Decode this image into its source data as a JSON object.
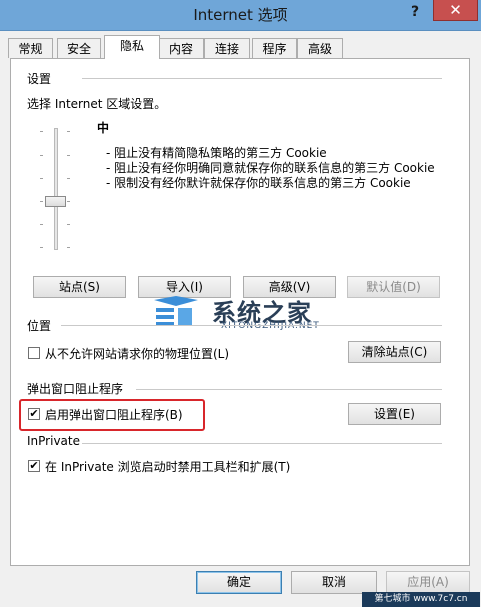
{
  "window": {
    "title": "Internet 选项",
    "help": "?",
    "close": "✕"
  },
  "tabs": [
    "常规",
    "安全",
    "隐私",
    "内容",
    "连接",
    "程序",
    "高级"
  ],
  "settings": {
    "header": "设置",
    "zone_prompt": "选择 Internet 区域设置。",
    "level": "中",
    "descriptions": [
      "- 阻止没有精简隐私策略的第三方 Cookie",
      "- 阻止没有经你明确同意就保存你的联系信息的第三方 Cookie",
      "- 限制没有经你默许就保存你的联系信息的第三方 Cookie"
    ],
    "buttons": {
      "sites": "站点(S)",
      "import": "导入(I)",
      "advanced": "高级(V)",
      "default": "默认值(D)"
    }
  },
  "location": {
    "header": "位置",
    "checkbox_label": "从不允许网站请求你的物理位置(L)",
    "checked": false,
    "clear_button": "清除站点(C)"
  },
  "popup": {
    "header": "弹出窗口阻止程序",
    "checkbox_label": "启用弹出窗口阻止程序(B)",
    "checked": true,
    "settings_button": "设置(E)"
  },
  "inprivate": {
    "header": "InPrivate",
    "checkbox_label": "在 InPrivate 浏览启动时禁用工具栏和扩展(T)",
    "checked": true
  },
  "footer": {
    "ok": "确定",
    "cancel": "取消",
    "apply": "应用(A)"
  },
  "watermark": {
    "title": "系统之家",
    "subtitle": "XITONGZHIJIA.NET",
    "corner": "第七城市 www.7c7.cn"
  },
  "colors": {
    "highlight": "#d8262b",
    "titlebar": "#6fa6d8",
    "close": "#c7504f"
  }
}
